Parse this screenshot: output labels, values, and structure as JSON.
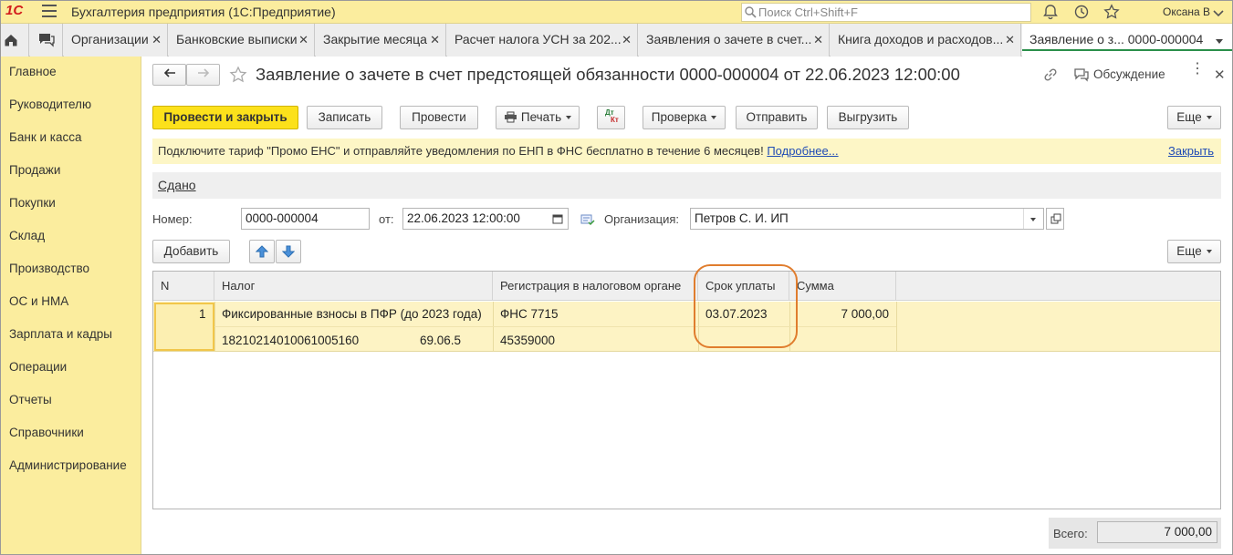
{
  "app": {
    "logo": "1С",
    "title": "Бухгалтерия предприятия  (1С:Предприятие)",
    "search_placeholder": "Поиск Ctrl+Shift+F",
    "user": "Оксана В"
  },
  "tabs": [
    {
      "label": "Организации"
    },
    {
      "label": "Банковские выписки"
    },
    {
      "label": "Закрытие месяца"
    },
    {
      "label": "Расчет налога УСН за 202..."
    },
    {
      "label": "Заявления о зачете в счет..."
    },
    {
      "label": "Книга доходов и расходов..."
    },
    {
      "label": "Заявление о з...  0000-000004"
    }
  ],
  "sidebar": {
    "items": [
      {
        "label": "Главное"
      },
      {
        "label": "Руководителю"
      },
      {
        "label": "Банк и касса"
      },
      {
        "label": "Продажи"
      },
      {
        "label": "Покупки"
      },
      {
        "label": "Склад"
      },
      {
        "label": "Производство"
      },
      {
        "label": "ОС и НМА"
      },
      {
        "label": "Зарплата и кадры"
      },
      {
        "label": "Операции"
      },
      {
        "label": "Отчеты"
      },
      {
        "label": "Справочники"
      },
      {
        "label": "Администрирование"
      }
    ]
  },
  "document": {
    "title": "Заявление о зачете в счет предстоящей обязанности 0000-000004 от 22.06.2023 12:00:00",
    "discussion": "Обсуждение"
  },
  "toolbar": {
    "post_close": "Провести и закрыть",
    "save": "Записать",
    "post": "Провести",
    "print": "Печать",
    "dtkt_top": "Дт",
    "dtkt_bottom": "Кт",
    "check": "Проверка",
    "send": "Отправить",
    "unload": "Выгрузить",
    "more": "Еще"
  },
  "banner": {
    "text": "Подключите тариф \"Промо ЕНС\" и отправляйте уведомления по ЕНП в ФНС бесплатно в течение 6 месяцев!",
    "more_link": "Подробнее...",
    "close_link": "Закрыть"
  },
  "status": {
    "label": "Сдано"
  },
  "form": {
    "number_label": "Номер:",
    "number_value": "0000-000004",
    "date_label": "от:",
    "date_value": "22.06.2023 12:00:00",
    "org_label": "Организация:",
    "org_value": "Петров С. И. ИП"
  },
  "table_toolbar": {
    "add": "Добавить",
    "more": "Еще"
  },
  "table": {
    "columns": [
      "N",
      "Налог",
      "Регистрация в налоговом органе",
      "Срок уплаты",
      "Сумма"
    ],
    "rows": [
      {
        "n": "1",
        "tax": "Фиксированные взносы в ПФР (до 2023 года)",
        "kbk": "18210214010061005160",
        "code": "69.06.5",
        "registration": "ФНС 7715",
        "oktmo": "45359000",
        "due_date": "03.07.2023",
        "amount": "7 000,00"
      }
    ]
  },
  "footer": {
    "total_label": "Всего:",
    "total_value": "7 000,00"
  },
  "colors": {
    "sidebar_bg": "#fbed9e",
    "primary_button": "#fce11b",
    "row_highlight": "#fdf3c4",
    "annotation": "#e07d2e",
    "link": "#1f4bb5"
  }
}
